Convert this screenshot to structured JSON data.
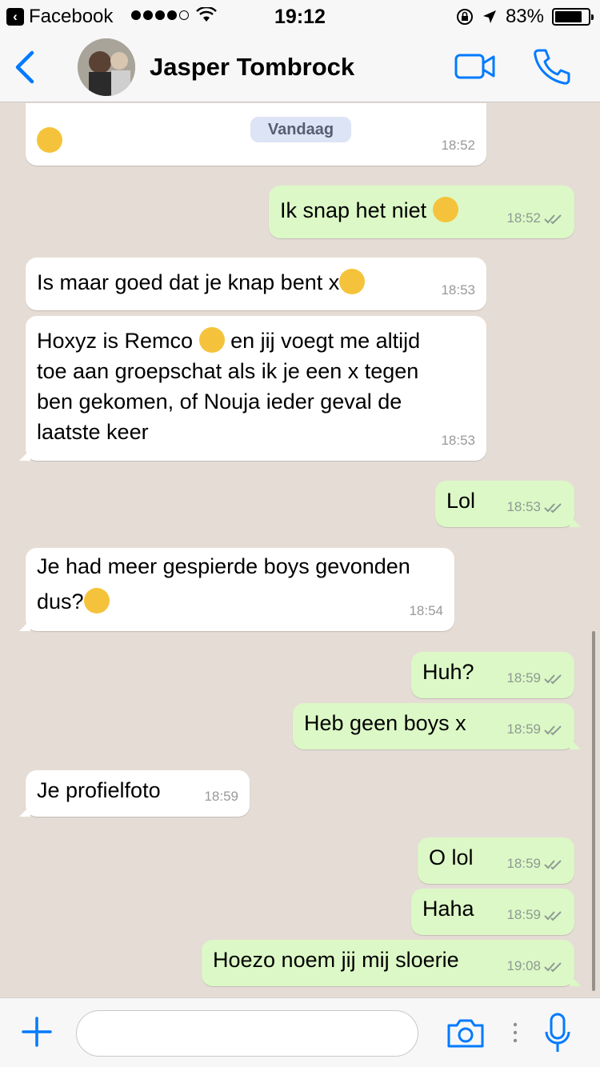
{
  "status": {
    "back_app": "Facebook",
    "time": "19:12",
    "battery": "83%",
    "battery_level": 0.83
  },
  "header": {
    "contact_name": "Jasper Tombrock"
  },
  "chat": {
    "day_label": "Vandaag",
    "messages": [
      {
        "dir": "in",
        "text": "",
        "time": "18:52"
      },
      {
        "dir": "out",
        "text": "Ik snap het niet",
        "time": "18:52"
      },
      {
        "dir": "in",
        "text": "Is maar goed dat je knap bent x",
        "time": "18:53"
      },
      {
        "dir": "in",
        "text": "Hoxyz is Remco",
        "text_b": "en jij voegt me altijd",
        "text_c": "toe aan groepschat als ik je een x tegen",
        "text_d": "ben gekomen, of Nouja ieder geval de",
        "text_e": "laatste keer",
        "time": "18:53"
      },
      {
        "dir": "out",
        "text": "Lol",
        "time": "18:53"
      },
      {
        "dir": "in",
        "text": "Je had meer gespierde boys gevonden",
        "text_b": "dus?",
        "time": "18:54"
      },
      {
        "dir": "out",
        "text": "Huh?",
        "time": "18:59"
      },
      {
        "dir": "out",
        "text": "Heb geen boys x",
        "time": "18:59"
      },
      {
        "dir": "in",
        "text": "Je profielfoto",
        "time": "18:59"
      },
      {
        "dir": "out",
        "text": "O lol",
        "time": "18:59"
      },
      {
        "dir": "out",
        "text": "Haha",
        "time": "18:59"
      },
      {
        "dir": "out",
        "text": "Hoezo noem jij mij sloerie",
        "time": "19:08"
      }
    ]
  },
  "input": {
    "value": "",
    "placeholder": ""
  },
  "colors": {
    "accent": "#007aff",
    "outgoing_bubble": "#dcf8c6",
    "incoming_bubble": "#ffffff",
    "chat_background": "#e5ddd5",
    "read_ticks": "#8f9a94"
  }
}
